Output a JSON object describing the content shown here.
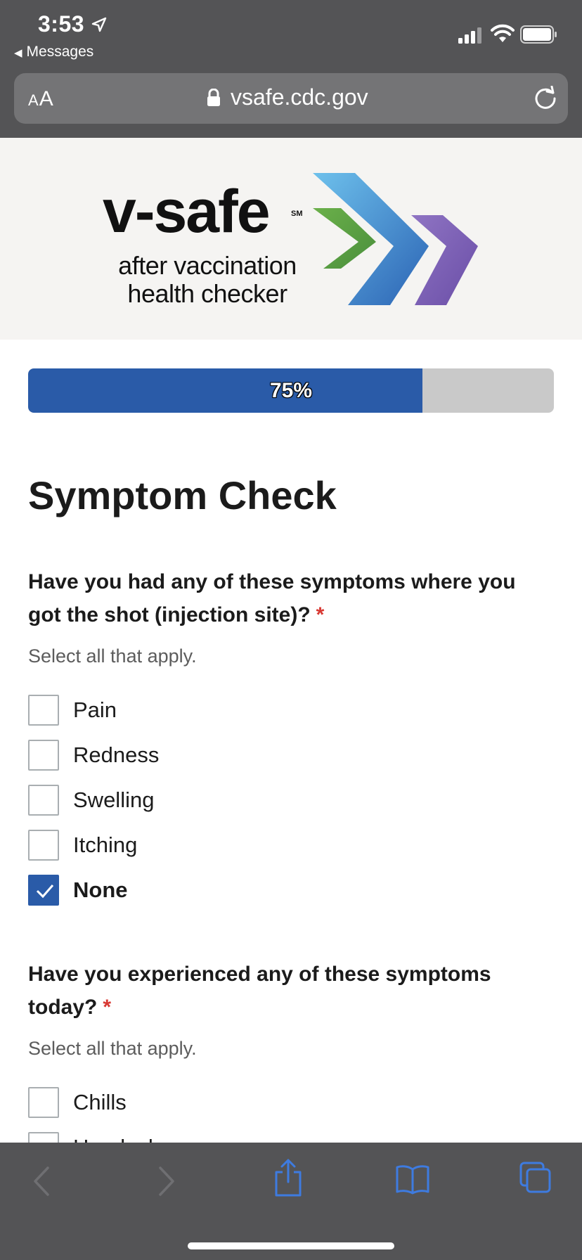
{
  "status_bar": {
    "time": "3:53",
    "back_app": "Messages"
  },
  "browser": {
    "text_size_label_small": "A",
    "text_size_label_large": "A",
    "url": "vsafe.cdc.gov"
  },
  "logo": {
    "wordmark": "v-safe",
    "service_mark": "SM",
    "tagline_line1": "after vaccination",
    "tagline_line2": "health checker"
  },
  "progress": {
    "value": 0.75,
    "label": "75%"
  },
  "page": {
    "title": "Symptom Check"
  },
  "questions": [
    {
      "text": "Have you had any of these symptoms where you got the shot (injection site)?",
      "required_mark": "*",
      "hint": "Select all that apply.",
      "options": [
        {
          "label": "Pain",
          "checked": false
        },
        {
          "label": "Redness",
          "checked": false
        },
        {
          "label": "Swelling",
          "checked": false
        },
        {
          "label": "Itching",
          "checked": false
        },
        {
          "label": "None",
          "checked": true
        }
      ]
    },
    {
      "text": "Have you experienced any of these symptoms today?",
      "required_mark": "*",
      "hint": "Select all that apply.",
      "options": [
        {
          "label": "Chills",
          "checked": false
        },
        {
          "label": "Headache",
          "checked": false
        }
      ]
    }
  ],
  "colors": {
    "accent": "#2a5ba8",
    "required": "#d83933",
    "chrome": "#545456",
    "toolbar_icon": "#3e7be0"
  },
  "icons": {
    "location": "location-arrow-icon",
    "signal": "cellular-signal-icon",
    "wifi": "wifi-icon",
    "battery": "battery-icon",
    "lock": "lock-icon",
    "reload": "reload-icon",
    "back": "chevron-left-icon",
    "forward": "chevron-right-icon",
    "share": "share-icon",
    "bookmarks": "book-icon",
    "tabs": "tabs-icon"
  }
}
